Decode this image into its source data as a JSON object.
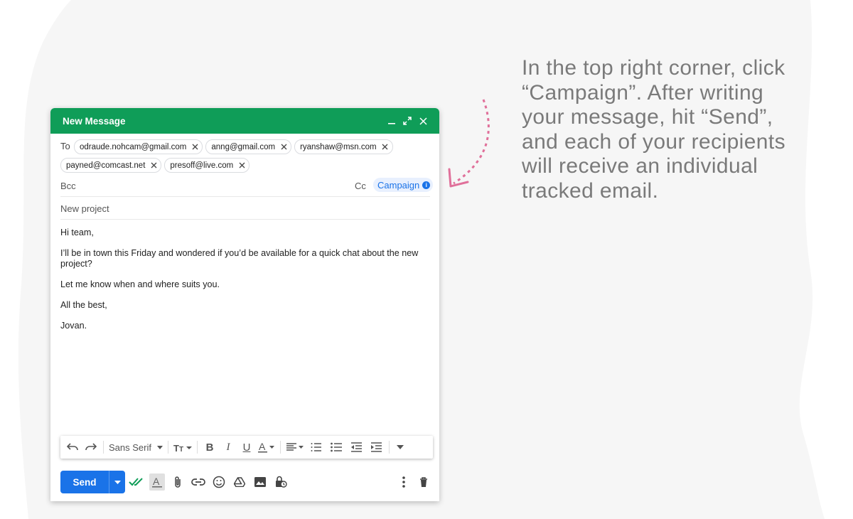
{
  "compose": {
    "title": "New Message",
    "to_label": "To",
    "recipients_line1": [
      "odraude.nohcam@gmail.com",
      "anng@gmail.com",
      "ryanshaw@msn.com"
    ],
    "recipients_line2": [
      "payned@comcast.net",
      "presoff@live.com"
    ],
    "bcc_label": "Bcc",
    "cc_label": "Cc",
    "campaign_label": "Campaign",
    "subject": "New project",
    "body": {
      "greeting": "Hi team,",
      "paragraph": "I’ll be in town this Friday and wondered if you’d be available for a quick chat about the new project?",
      "line2": "Let me know when and where suits you.",
      "closing": "All the best,",
      "signature": "Jovan."
    },
    "toolbar": {
      "font_family": "Sans Serif"
    },
    "send_label": "Send"
  },
  "instruction_text": "In the top right corner, click “Campaign”. After writing your message, hit “Send”, and each of your recipients will receive an individual tracked email.",
  "colors": {
    "header_green": "#0f9d58",
    "send_blue": "#1a73e8",
    "arrow_pink": "#e0709a",
    "instruction_gray": "#7a7a7a",
    "background_blob": "#f6f6f6"
  }
}
